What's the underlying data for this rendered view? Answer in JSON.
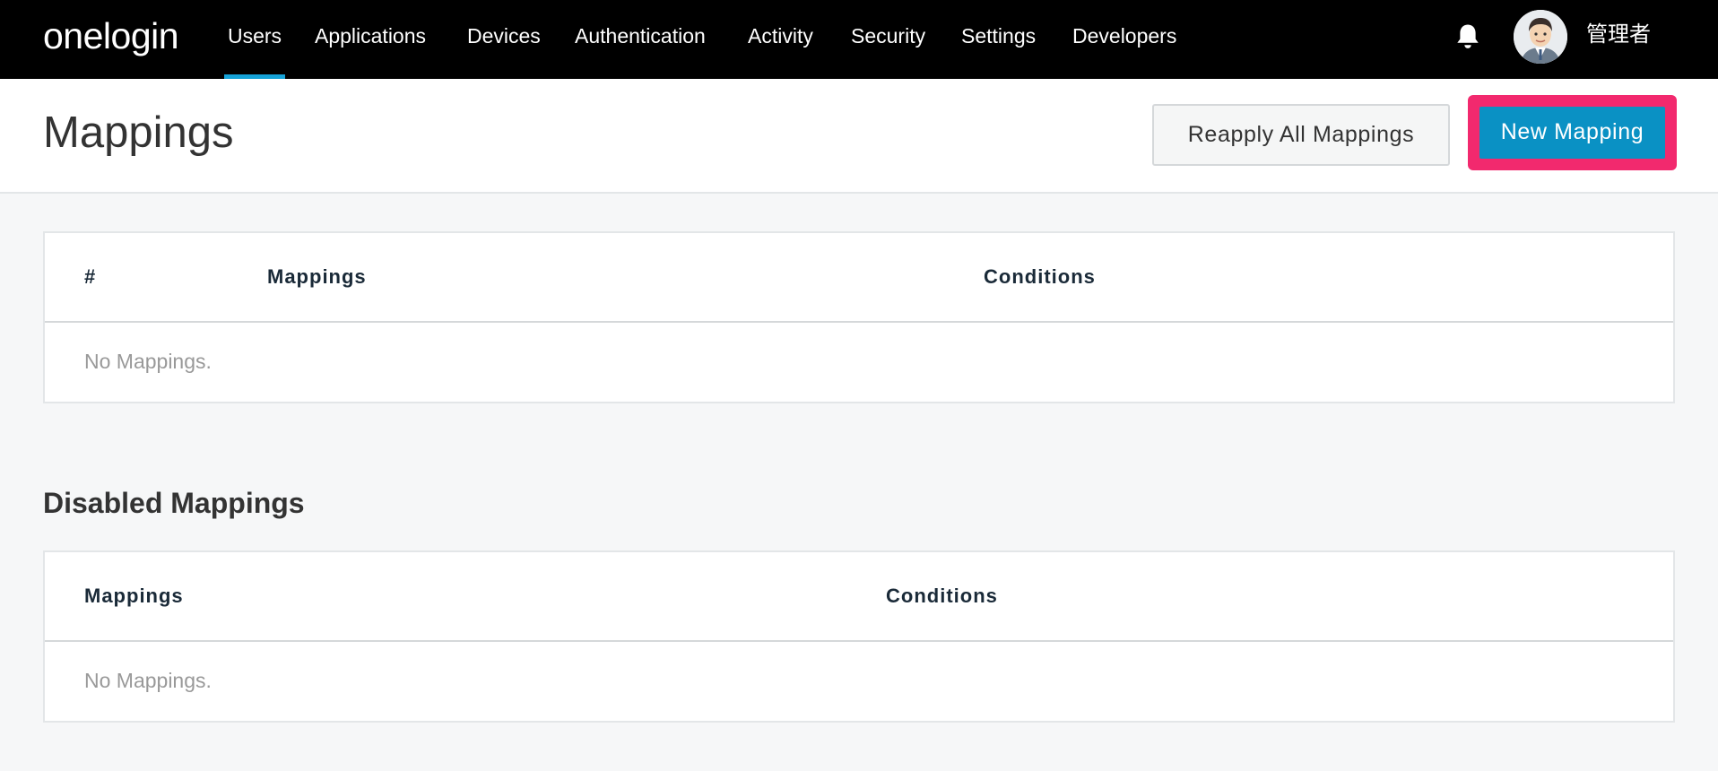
{
  "app": {
    "logo": "onelogin"
  },
  "nav": {
    "items": [
      {
        "label": "Users",
        "active": true
      },
      {
        "label": "Applications"
      },
      {
        "label": "Devices"
      },
      {
        "label": "Authentication"
      },
      {
        "label": "Activity"
      },
      {
        "label": "Security"
      },
      {
        "label": "Settings"
      },
      {
        "label": "Developers"
      }
    ],
    "accent_color": "#16a3d8"
  },
  "user": {
    "name": "管理者",
    "avatar_icon": "user-avatar",
    "notifications_icon": "bell-icon"
  },
  "header": {
    "title": "Mappings",
    "reapply_label": "Reapply All Mappings",
    "new_label": "New Mapping",
    "highlight_color": "#f2296e",
    "primary_color": "#0a91c4"
  },
  "mappings_table": {
    "columns": [
      "#",
      "Mappings",
      "Conditions"
    ],
    "empty_text": "No Mappings."
  },
  "disabled_section": {
    "title": "Disabled Mappings",
    "columns": [
      "Mappings",
      "Conditions"
    ],
    "empty_text": "No Mappings."
  }
}
